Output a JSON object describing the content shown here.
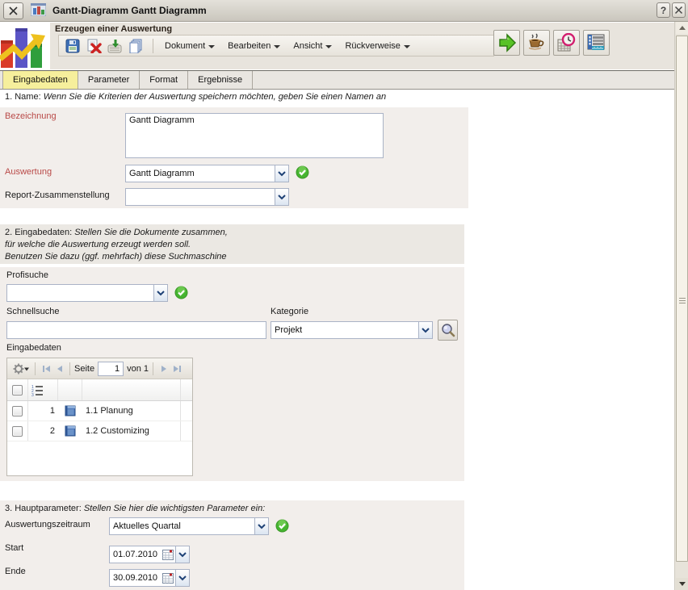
{
  "titlebar": {
    "title": "Gantt-Diagramm Gantt Diagramm",
    "help_label": "?"
  },
  "toolbar": {
    "heading": "Erzeugen einer Auswertung",
    "menus": [
      {
        "label": "Dokument"
      },
      {
        "label": "Bearbeiten"
      },
      {
        "label": "Ansicht"
      },
      {
        "label": "Rückverweise"
      }
    ]
  },
  "tabs": [
    {
      "label": "Eingabedaten"
    },
    {
      "label": "Parameter"
    },
    {
      "label": "Format"
    },
    {
      "label": "Ergebnisse"
    }
  ],
  "sections": {
    "name": {
      "prefix": "1. Name:",
      "note": "Wenn Sie die Kriterien der Auswertung speichern möchten, geben Sie einen Namen an",
      "bezeichnung_label": "Bezeichnung",
      "bezeichnung_value": "Gantt Diagramm",
      "auswertung_label": "Auswertung",
      "auswertung_value": "Gantt Diagramm",
      "report_label": "Report-Zusammenstellung",
      "report_value": ""
    },
    "eingabedaten": {
      "prefix": "2. Eingabedaten:",
      "note_line1": "Stellen Sie die Dokumente zusammen,",
      "note_line2": "für welche die Auswertung erzeugt werden soll.",
      "note_line3": "Benutzen Sie dazu (ggf. mehrfach) diese Suchmaschine",
      "profisuche_label": "Profisuche",
      "profisuche_value": "",
      "schnellsuche_label": "Schnellsuche",
      "schnellsuche_value": "",
      "kategorie_label": "Kategorie",
      "kategorie_value": "Projekt",
      "grid_label": "Eingabedaten",
      "pager": {
        "page_label": "Seite",
        "page_value": "1",
        "total_label": "von 1"
      },
      "rows": [
        {
          "num": "1",
          "text": "1.1 Planung"
        },
        {
          "num": "2",
          "text": "1.2 Customizing"
        }
      ]
    },
    "hauptparameter": {
      "prefix": "3. Hauptparameter:",
      "note": "Stellen Sie hier die wichtigsten Parameter ein:",
      "zeitraum_label": "Auswertungszeitraum",
      "zeitraum_value": "Aktuelles Quartal",
      "start_label": "Start",
      "start_value": "01.07.2010",
      "ende_label": "Ende",
      "ende_value": "30.09.2010"
    }
  },
  "colors": {
    "active_tab": "#f6ef9c",
    "label_red": "#b94a48",
    "check_green": "#46b430"
  }
}
